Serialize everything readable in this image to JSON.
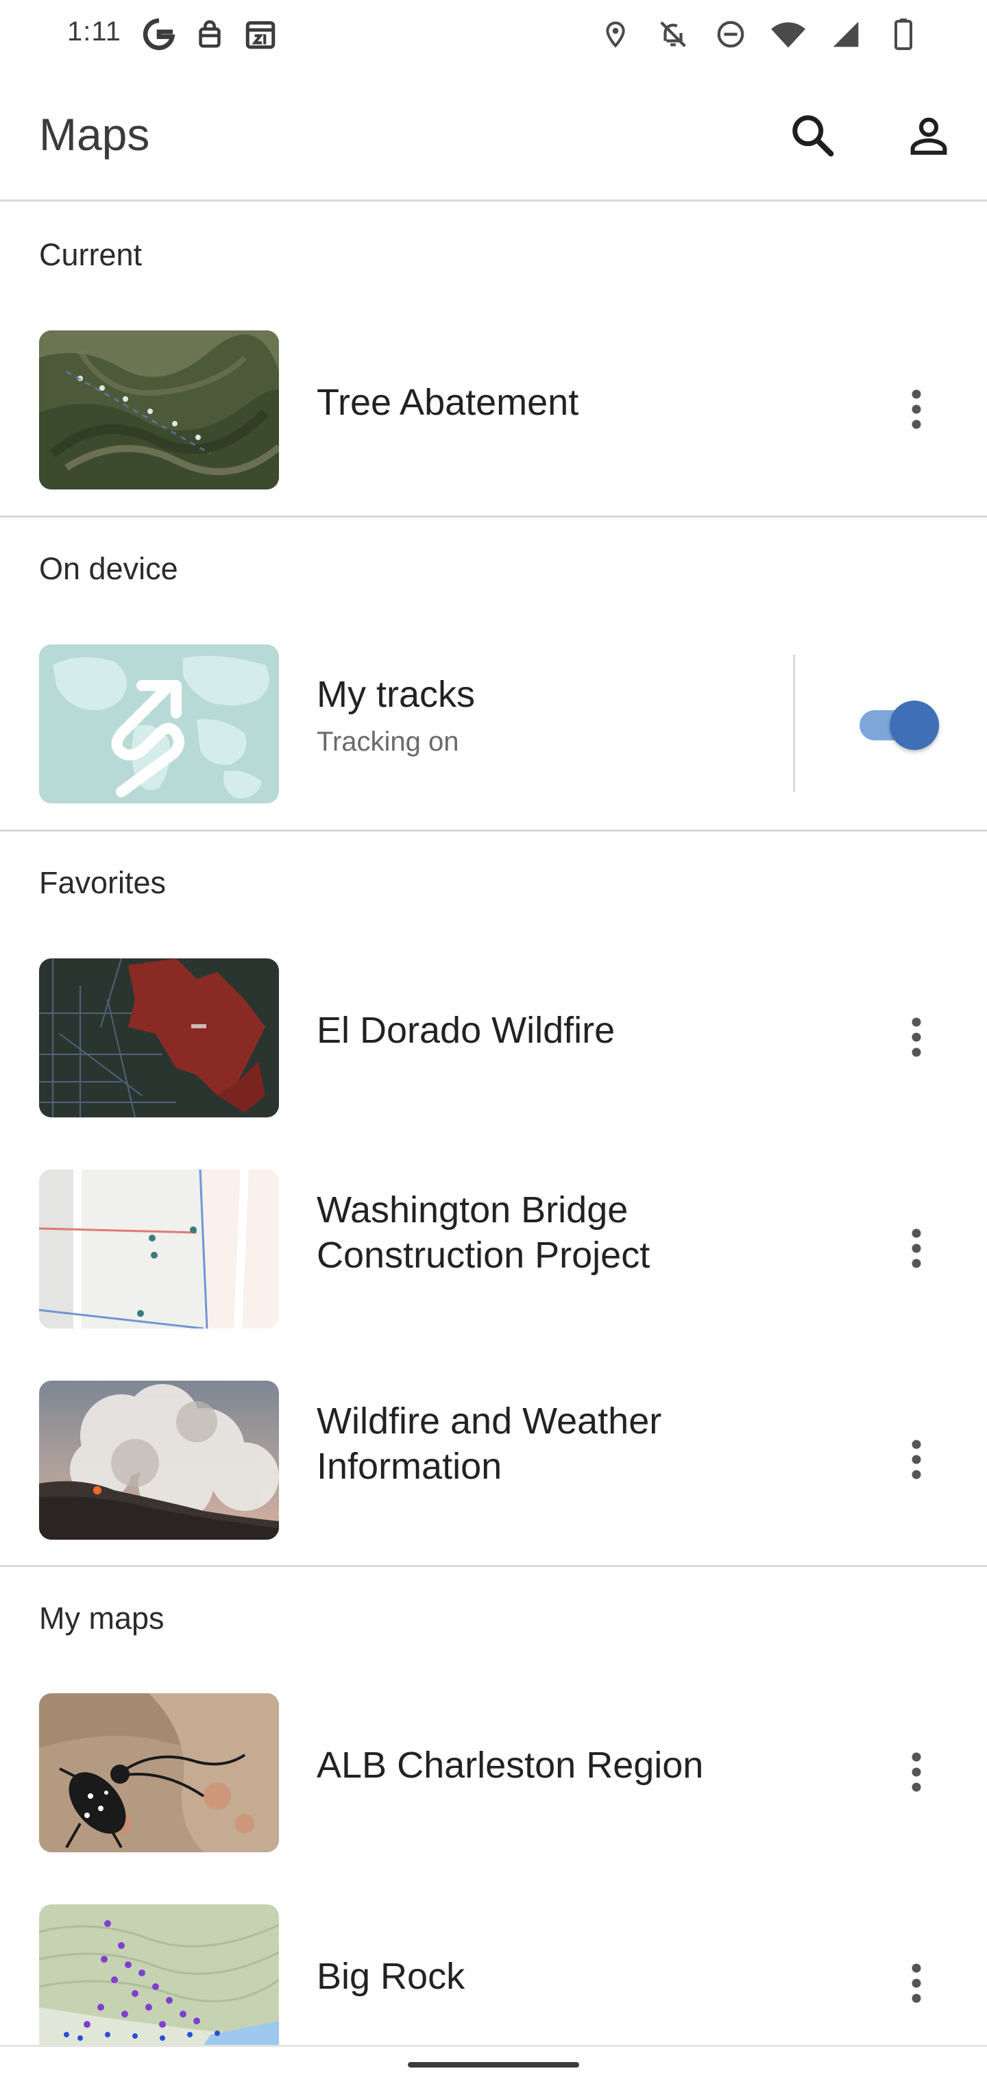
{
  "status_bar": {
    "time": "1:11",
    "left_icons": [
      "google-icon",
      "shopping-bag-icon",
      "calendar-icon"
    ],
    "right_icons": [
      "location-icon",
      "notifications-off-icon",
      "do-not-disturb-icon",
      "wifi-icon",
      "signal-icon",
      "battery-icon"
    ]
  },
  "app_bar": {
    "title": "Maps",
    "actions": [
      "search-icon",
      "account-icon"
    ]
  },
  "sections": {
    "current": {
      "title": "Current",
      "items": [
        {
          "title": "Tree Abatement",
          "thumb": "satellite-terrain-track"
        }
      ]
    },
    "on_device": {
      "title": "On device",
      "items": [
        {
          "title": "My tracks",
          "subtitle": "Tracking on",
          "toggle_on": true,
          "thumb": "world-map-track-icon"
        }
      ]
    },
    "favorites": {
      "title": "Favorites",
      "items": [
        {
          "title": "El Dorado Wildfire",
          "thumb": "dark-map-fire-perimeter"
        },
        {
          "title": "Washington Bridge\nConstruction Project",
          "thumb": "street-map-points"
        },
        {
          "title": "Wildfire and Weather\nInformation",
          "thumb": "smoke-plume-photo"
        }
      ]
    },
    "my_maps": {
      "title": "My maps",
      "items": [
        {
          "title": "ALB Charleston Region",
          "thumb": "beetle-photo"
        },
        {
          "title": "Big Rock",
          "thumb": "terrain-map-purple-points"
        }
      ]
    }
  },
  "colors": {
    "accent": "#3f6fb7",
    "toggle_track": "#7fa6d9",
    "divider": "#d9d9d9"
  }
}
